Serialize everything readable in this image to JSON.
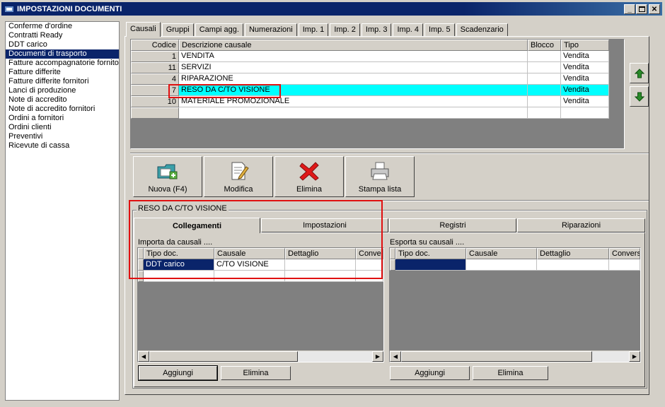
{
  "window": {
    "title": "IMPOSTAZIONI DOCUMENTI",
    "icon": "app-icon",
    "controls": [
      "minimize",
      "maximize",
      "close"
    ]
  },
  "nav": {
    "items": [
      "Conferme d'ordine",
      "Contratti Ready",
      "DDT carico",
      "Documenti di trasporto",
      "Fatture accompagnatorie fornitori",
      "Fatture differite",
      "Fatture differite fornitori",
      "Lanci di produzione",
      "Note di accredito",
      "Note di accredito fornitori",
      "Ordini a fornitori",
      "Ordini clienti",
      "Preventivi",
      "Ricevute di cassa"
    ],
    "selected": "Documenti di trasporto"
  },
  "tabs": {
    "items": [
      "Causali",
      "Gruppi",
      "Campi agg.",
      "Numerazioni",
      "Imp. 1",
      "Imp. 2",
      "Imp. 3",
      "Imp. 4",
      "Imp. 5",
      "Scadenzario"
    ],
    "active": "Causali"
  },
  "causali_grid": {
    "columns": [
      "Codice",
      "Descrizione causale",
      "Blocco",
      "Tipo"
    ],
    "rows": [
      {
        "codice": "1",
        "descrizione": "VENDITA",
        "blocco": "",
        "tipo": "Vendita"
      },
      {
        "codice": "11",
        "descrizione": "SERVIZI",
        "blocco": "",
        "tipo": "Vendita"
      },
      {
        "codice": "4",
        "descrizione": "RIPARAZIONE",
        "blocco": "",
        "tipo": "Vendita"
      },
      {
        "codice": "7",
        "descrizione": "RESO DA C/TO VISIONE",
        "blocco": "",
        "tipo": "Vendita"
      },
      {
        "codice": "10",
        "descrizione": "MATERIALE PROMOZIONALE",
        "blocco": "",
        "tipo": "Vendita"
      }
    ],
    "selected_row": "7"
  },
  "toolbar": {
    "nuova": "Nuova (F4)",
    "modifica": "Modifica",
    "elimina": "Elimina",
    "stampa": "Stampa lista"
  },
  "detail": {
    "group_title": "RESO DA C/TO VISIONE",
    "tabs": [
      "Collegamenti",
      "Impostazioni",
      "Registri",
      "Riparazioni"
    ],
    "active_tab": "Collegamenti"
  },
  "importa": {
    "label": "Importa da causali ....",
    "columns": [
      "Tipo doc.",
      "Causale",
      "Dettaglio",
      "Conversi"
    ],
    "rows": [
      {
        "tipo": "DDT carico",
        "causale": "C/TO VISIONE",
        "dettaglio": "",
        "conversione": ""
      }
    ],
    "add_label": "Aggiungi",
    "remove_label": "Elimina"
  },
  "esporta": {
    "label": "Esporta su causali ....",
    "columns": [
      "Tipo doc.",
      "Causale",
      "Dettaglio",
      "Conversi"
    ],
    "rows": [
      {
        "tipo": "",
        "causale": "",
        "dettaglio": "",
        "conversione": ""
      }
    ],
    "add_label": "Aggiungi",
    "remove_label": "Elimina"
  },
  "colors": {
    "title_bg": "#0a246a",
    "selection": "#0a246a",
    "highlight_row": "#00ffff",
    "annotation": "#e01010",
    "arrow_green": "#2a8a2a"
  }
}
